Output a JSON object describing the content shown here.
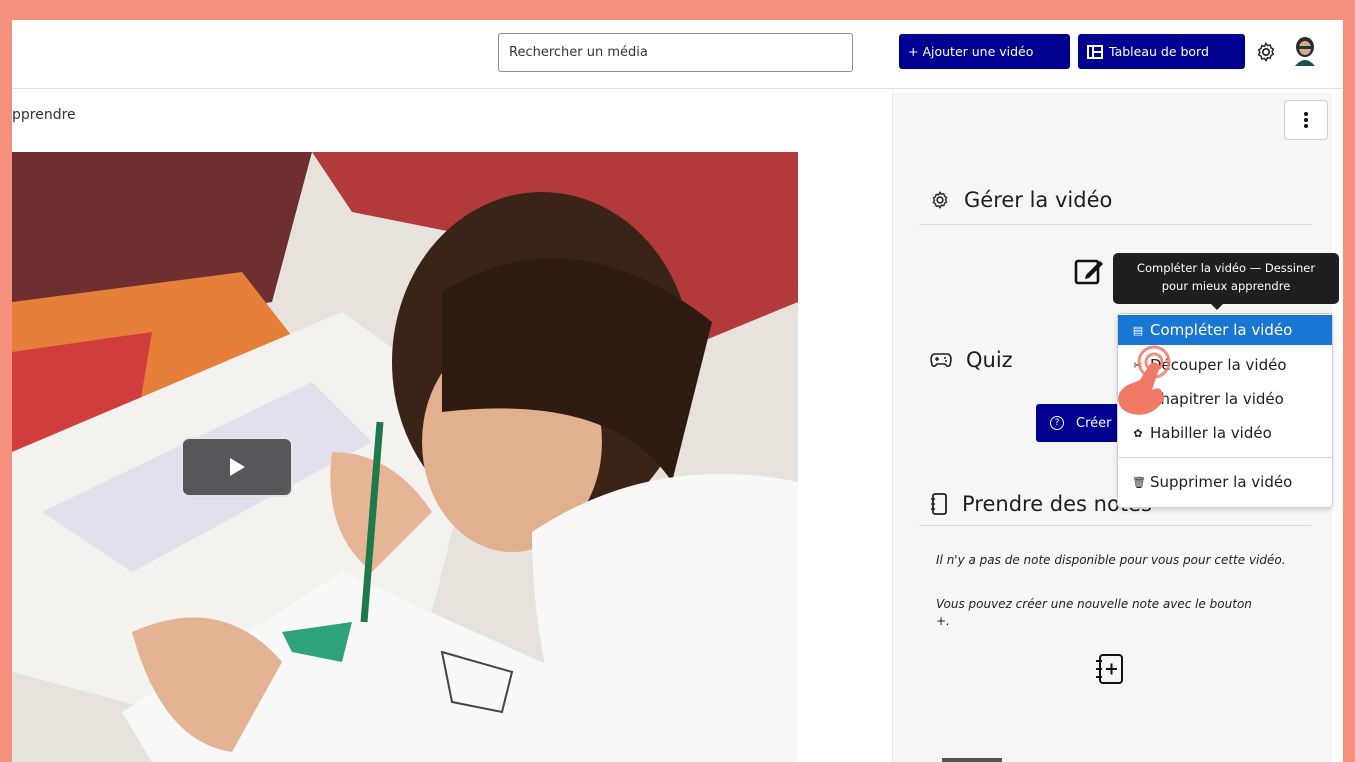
{
  "header": {
    "search_placeholder": "Rechercher un média",
    "add_video_label": "+ Ajouter une vidéo",
    "dashboard_label": "Tableau de bord",
    "brand_color": "#000091",
    "icons": [
      "gear-icon",
      "dashboard-icon",
      "avatar"
    ]
  },
  "breadcrumb": "pprendre",
  "video": {
    "play_icon": "play-icon"
  },
  "sidebar": {
    "manage_title": "Gérer la vidéo",
    "quiz_title": "Quiz",
    "quiz_button_label": "Créer",
    "notes_title": "Prendre des notes",
    "notes_empty_line1": "Il n'y a pas de note disponible pour vous pour cette vidéo.",
    "notes_empty_line2": "Vous pouvez créer une nouvelle note avec le bouton +."
  },
  "tooltip": {
    "line1": "Compléter la vidéo — Dessiner",
    "line2": "pour mieux apprendre"
  },
  "menu": {
    "items": [
      {
        "label": "Compléter la vidéo",
        "icon": "document-icon",
        "active": true
      },
      {
        "label": "Découper la vidéo",
        "icon": "scissors-icon",
        "active": false
      },
      {
        "label": "Chapitrer la vidéo",
        "icon": "list-icon",
        "active": false
      },
      {
        "label": "Habiller la vidéo",
        "icon": "palette-icon",
        "active": false
      },
      {
        "label": "Supprimer la vidéo",
        "icon": "trash-icon",
        "active": false
      }
    ],
    "active_color": "#1976d2"
  }
}
